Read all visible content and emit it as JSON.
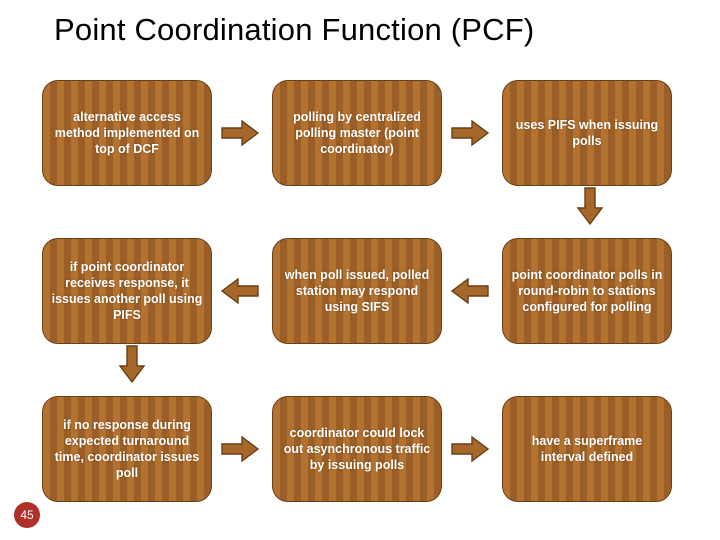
{
  "title": "Point Coordination Function (PCF)",
  "slideNumber": "45",
  "cards": {
    "r1c1": "alternative access method implemented on top of DCF",
    "r1c2": "polling by centralized polling master (point coordinator)",
    "r1c3": "uses PIFS when issuing polls",
    "r2c1": "if point coordinator receives response, it issues another poll using PIFS",
    "r2c2": "when poll issued, polled station may respond using SIFS",
    "r2c3": "point coordinator polls in round-robin to stations configured for polling",
    "r3c1": "if no response during expected turnaround time, coordinator issues poll",
    "r3c2": "coordinator could lock out asynchronous traffic by issuing polls",
    "r3c3": "have a superframe interval defined"
  },
  "colors": {
    "cardFill": "#a5682a",
    "cardStroke": "#6b3e12",
    "arrowFill": "#a5682a",
    "arrowStroke": "#6b3e12",
    "slideNumBg": "#b03028"
  }
}
